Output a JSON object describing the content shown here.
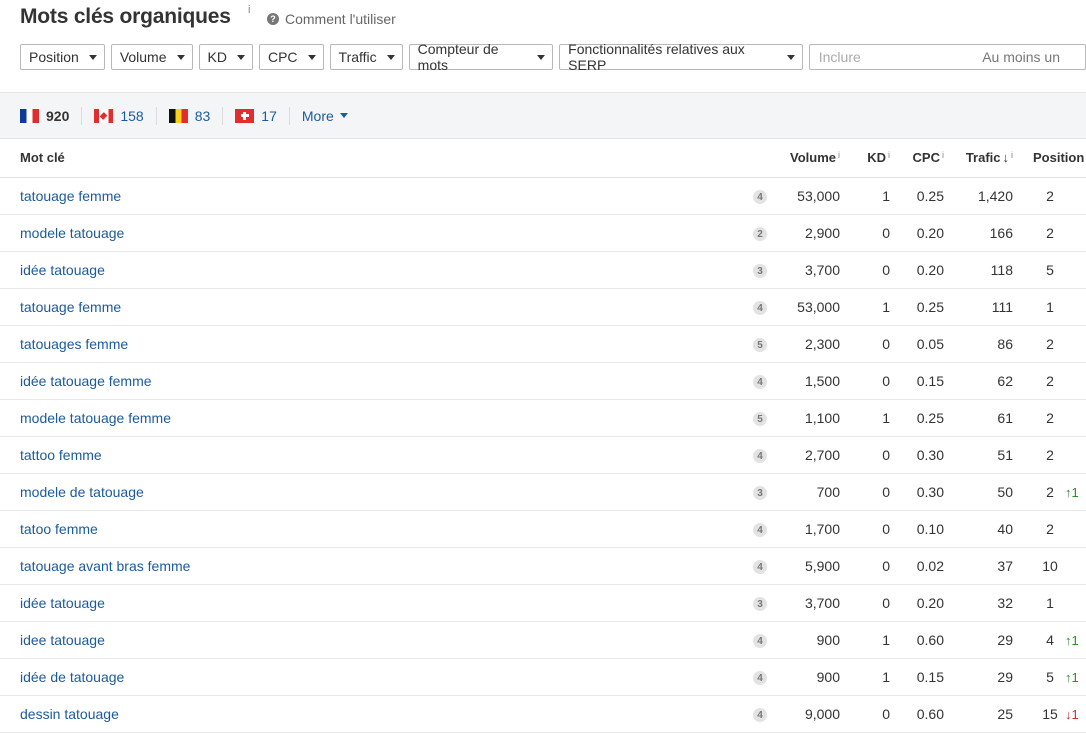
{
  "header": {
    "title": "Mots clés organiques",
    "title_info": "i",
    "help_icon": "?",
    "help_label": "Comment l'utiliser"
  },
  "filters": [
    {
      "label": "Position"
    },
    {
      "label": "Volume"
    },
    {
      "label": "KD"
    },
    {
      "label": "CPC"
    },
    {
      "label": "Traffic"
    },
    {
      "label": "Compteur de mots"
    },
    {
      "label": "Fonctionnalités relatives aux SERP"
    }
  ],
  "include": {
    "placeholder": "Inclure",
    "mode": "Au moins un"
  },
  "countries": [
    {
      "flag": "flag-fr",
      "count": "920",
      "active": true
    },
    {
      "flag": "flag-ca",
      "count": "158",
      "active": false
    },
    {
      "flag": "flag-be",
      "count": "83",
      "active": false
    },
    {
      "flag": "flag-ch",
      "count": "17",
      "active": false
    }
  ],
  "more_label": "More",
  "table": {
    "columns": {
      "keyword": "Mot clé",
      "volume": "Volume",
      "kd": "KD",
      "cpc": "CPC",
      "traffic": "Trafic",
      "position": "Position",
      "info": "i",
      "sort_arrow": "↓"
    },
    "rows": [
      {
        "keyword": "tatouage femme",
        "serp": "4",
        "volume": "53,000",
        "kd": "1",
        "cpc": "0.25",
        "traffic": "1,420",
        "position": "2",
        "change": "",
        "dir": ""
      },
      {
        "keyword": "modele tatouage",
        "serp": "2",
        "volume": "2,900",
        "kd": "0",
        "cpc": "0.20",
        "traffic": "166",
        "position": "2",
        "change": "",
        "dir": ""
      },
      {
        "keyword": "idée tatouage",
        "serp": "3",
        "volume": "3,700",
        "kd": "0",
        "cpc": "0.20",
        "traffic": "118",
        "position": "5",
        "change": "",
        "dir": ""
      },
      {
        "keyword": "tatouage femme",
        "serp": "4",
        "volume": "53,000",
        "kd": "1",
        "cpc": "0.25",
        "traffic": "111",
        "position": "1",
        "change": "",
        "dir": ""
      },
      {
        "keyword": "tatouages femme",
        "serp": "5",
        "volume": "2,300",
        "kd": "0",
        "cpc": "0.05",
        "traffic": "86",
        "position": "2",
        "change": "",
        "dir": ""
      },
      {
        "keyword": "idée tatouage femme",
        "serp": "4",
        "volume": "1,500",
        "kd": "0",
        "cpc": "0.15",
        "traffic": "62",
        "position": "2",
        "change": "",
        "dir": ""
      },
      {
        "keyword": "modele tatouage femme",
        "serp": "5",
        "volume": "1,100",
        "kd": "1",
        "cpc": "0.25",
        "traffic": "61",
        "position": "2",
        "change": "",
        "dir": ""
      },
      {
        "keyword": "tattoo femme",
        "serp": "4",
        "volume": "2,700",
        "kd": "0",
        "cpc": "0.30",
        "traffic": "51",
        "position": "2",
        "change": "",
        "dir": ""
      },
      {
        "keyword": "modele de tatouage",
        "serp": "3",
        "volume": "700",
        "kd": "0",
        "cpc": "0.30",
        "traffic": "50",
        "position": "2",
        "change": "↑1",
        "dir": "up"
      },
      {
        "keyword": "tatoo femme",
        "serp": "4",
        "volume": "1,700",
        "kd": "0",
        "cpc": "0.10",
        "traffic": "40",
        "position": "2",
        "change": "",
        "dir": ""
      },
      {
        "keyword": "tatouage avant bras femme",
        "serp": "4",
        "volume": "5,900",
        "kd": "0",
        "cpc": "0.02",
        "traffic": "37",
        "position": "10",
        "change": "",
        "dir": ""
      },
      {
        "keyword": "idée tatouage",
        "serp": "3",
        "volume": "3,700",
        "kd": "0",
        "cpc": "0.20",
        "traffic": "32",
        "position": "1",
        "change": "",
        "dir": ""
      },
      {
        "keyword": "idee tatouage",
        "serp": "4",
        "volume": "900",
        "kd": "1",
        "cpc": "0.60",
        "traffic": "29",
        "position": "4",
        "change": "↑1",
        "dir": "up"
      },
      {
        "keyword": "idée de tatouage",
        "serp": "4",
        "volume": "900",
        "kd": "1",
        "cpc": "0.15",
        "traffic": "29",
        "position": "5",
        "change": "↑1",
        "dir": "up"
      },
      {
        "keyword": "dessin tatouage",
        "serp": "4",
        "volume": "9,000",
        "kd": "0",
        "cpc": "0.60",
        "traffic": "25",
        "position": "15",
        "change": "↓1",
        "dir": "down"
      }
    ]
  }
}
